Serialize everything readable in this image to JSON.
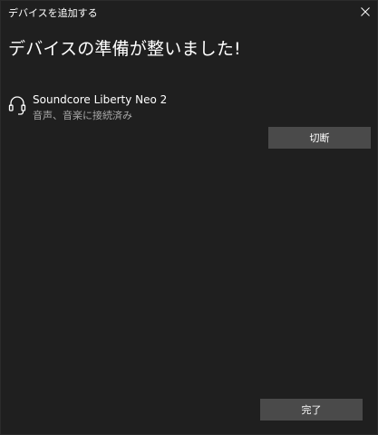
{
  "window": {
    "title": "デバイスを追加する"
  },
  "main": {
    "heading": "デバイスの準備が整いました!"
  },
  "device": {
    "name": "Soundcore Liberty Neo 2",
    "status": "音声、音楽に接続済み",
    "icon": "headset-icon"
  },
  "buttons": {
    "disconnect": "切断",
    "done": "完了"
  },
  "colors": {
    "background": "#1f1f1f",
    "button": "#4a4a4a",
    "secondary_text": "#a8a8a8"
  }
}
